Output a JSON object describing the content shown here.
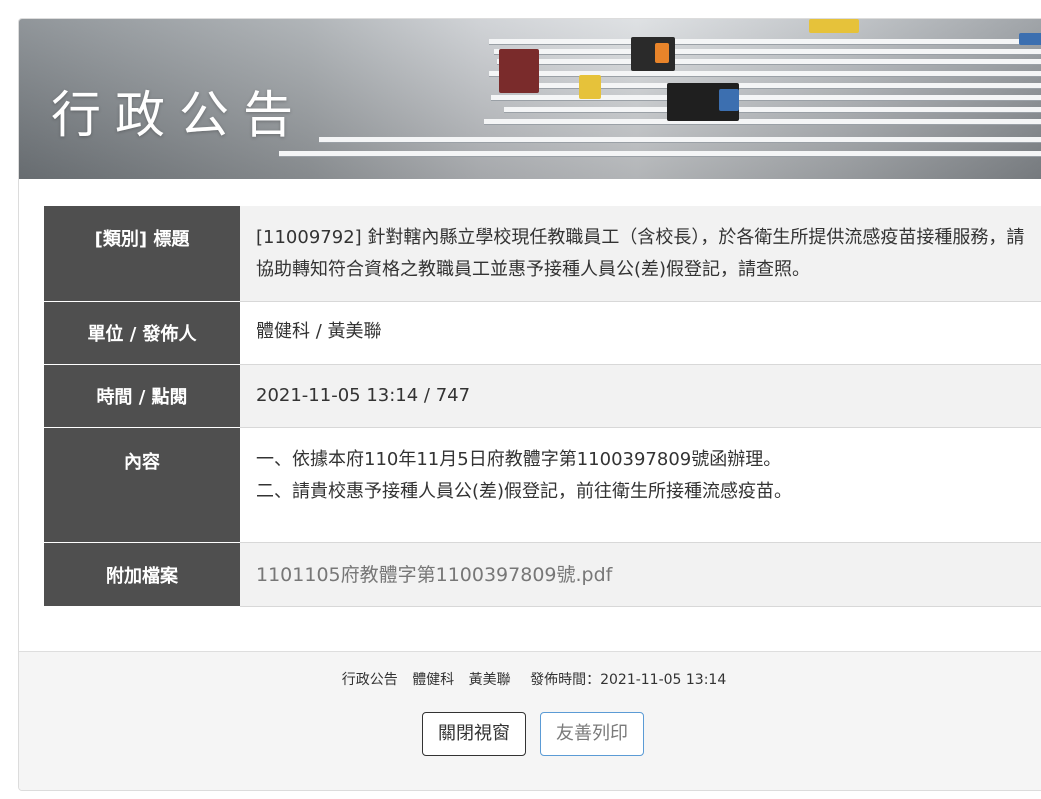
{
  "banner": {
    "title": "行政公告"
  },
  "details": {
    "rows": [
      {
        "label": "[類別] 標題",
        "value": "[11009792] 針對轄內縣立學校現任教職員工（含校長），於各衛生所提供流感疫苗接種服務，請協助轉知符合資格之教職員工並惠予接種人員公(差)假登記，請查照。"
      },
      {
        "label": "單位 / 發佈人",
        "value": "體健科 / 黃美聯"
      },
      {
        "label": "時間 / 點閱",
        "value": "2021-11-05 13:14 / 747"
      },
      {
        "label": "內容",
        "lines": [
          "一、依據本府110年11月5日府教體字第1100397809號函辦理。",
          "二、請貴校惠予接種人員公(差)假登記，前往衛生所接種流感疫苗。"
        ]
      },
      {
        "label": "附加檔案",
        "file": "1101105府教體字第1100397809號.pdf"
      }
    ]
  },
  "footer": {
    "meta": [
      "行政公告",
      "體健科",
      "黃美聯",
      "發佈時間：2021-11-05 13:14"
    ],
    "close_label": "關閉視窗",
    "print_label": "友善列印"
  }
}
